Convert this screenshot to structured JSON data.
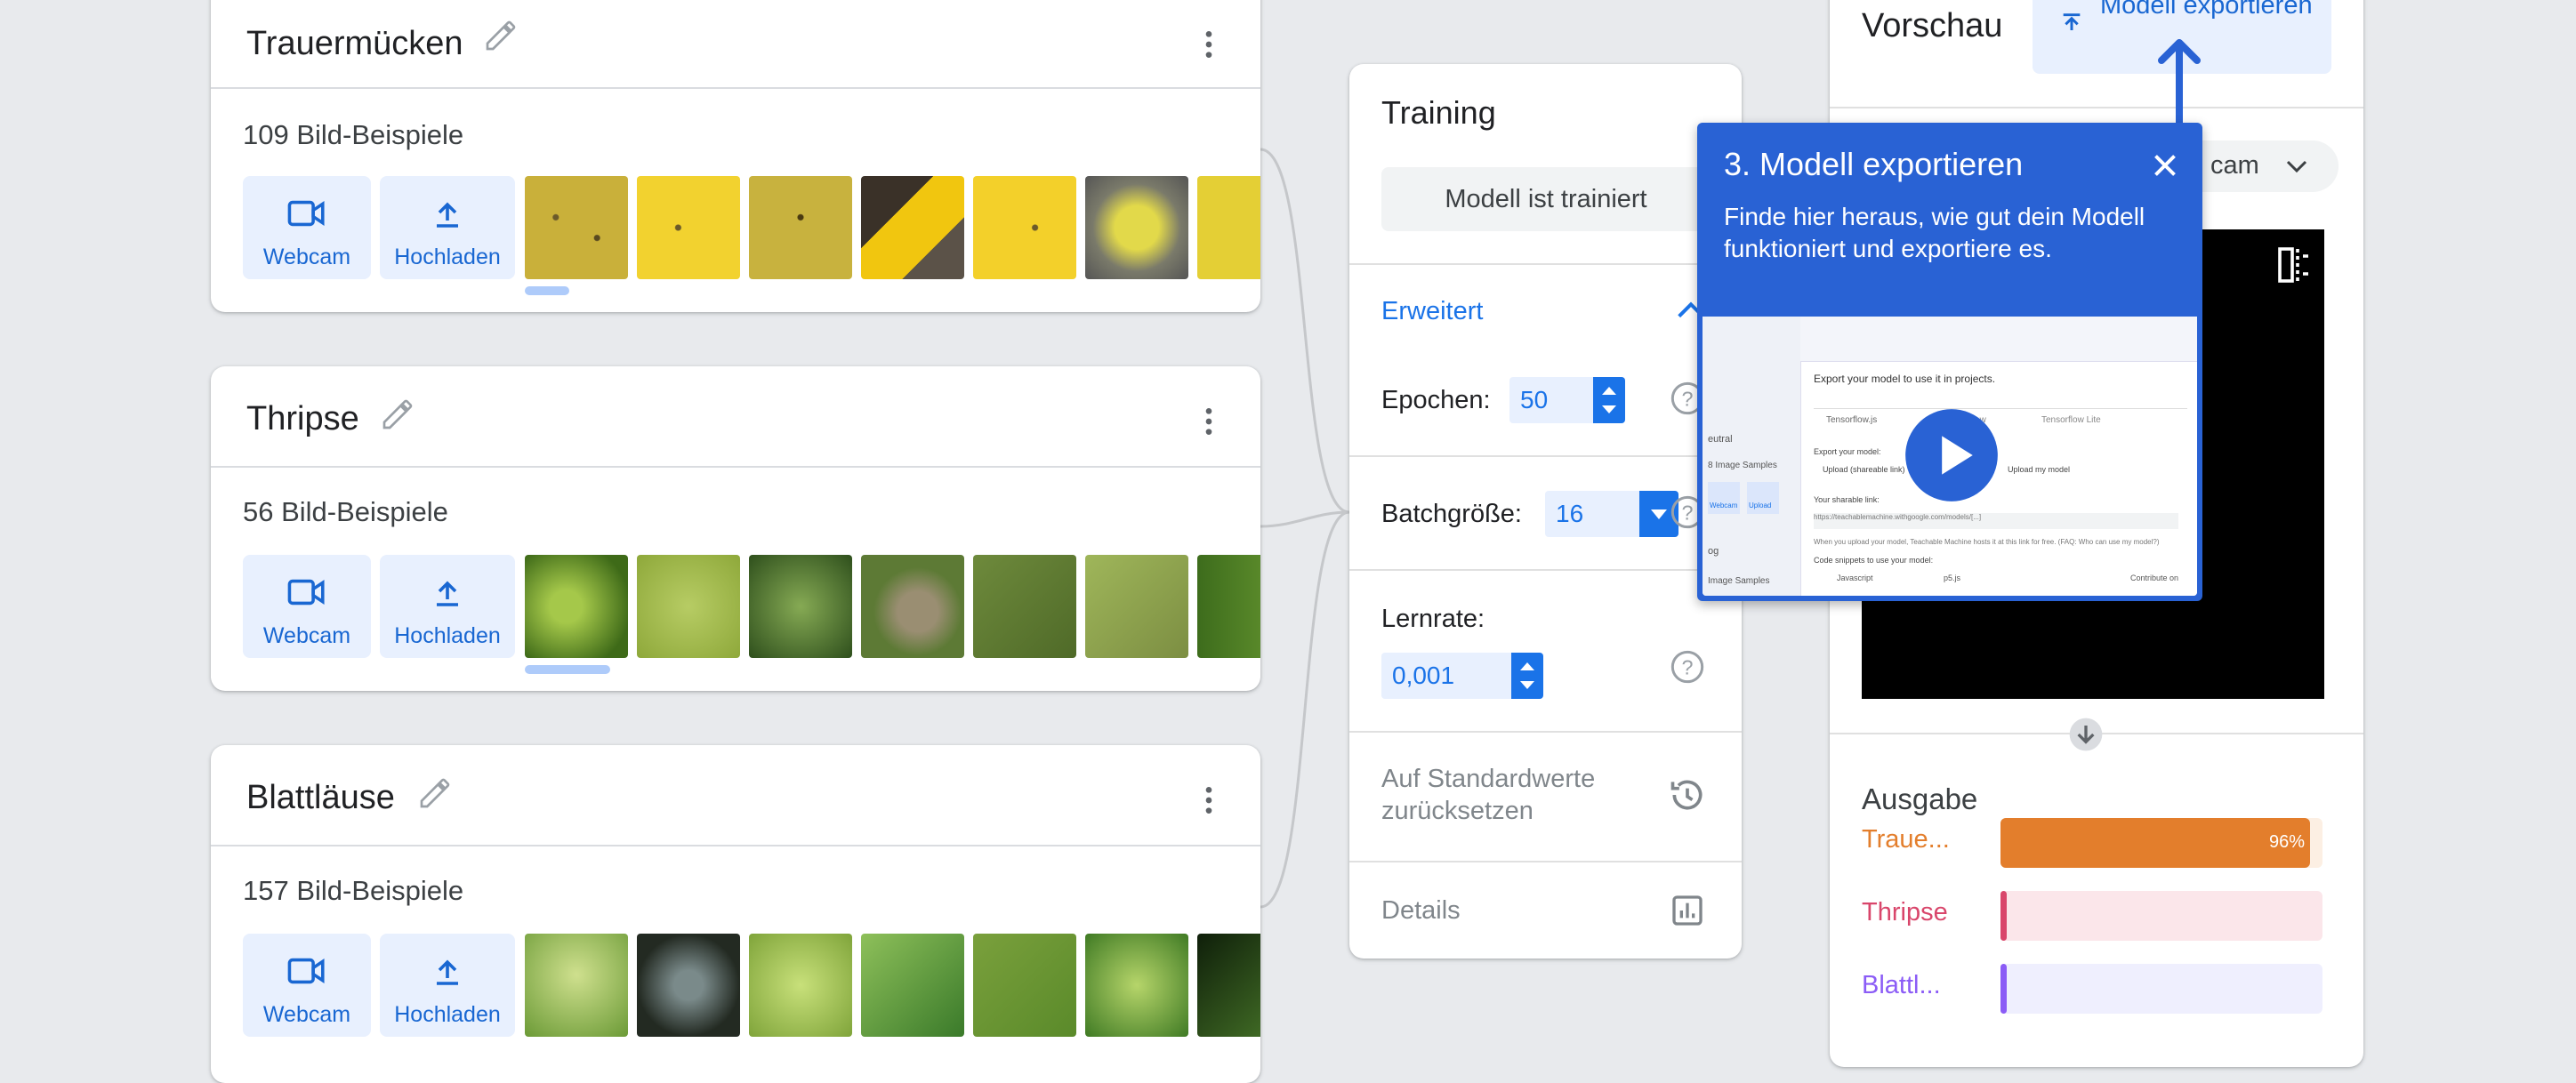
{
  "classes": [
    {
      "name": "Trauermücken",
      "count_label": "109 Bild-Beispiele"
    },
    {
      "name": "Thripse",
      "count_label": "56 Bild-Beispiele"
    },
    {
      "name": "Blattläuse",
      "count_label": "157 Bild-Beispiele"
    }
  ],
  "source_buttons": {
    "webcam": "Webcam",
    "upload": "Hochladen"
  },
  "training": {
    "title": "Training",
    "status_button": "Modell ist trainiert",
    "advanced_label": "Erweitert",
    "epochs_label": "Epochen:",
    "epochs_value": "50",
    "batch_label": "Batchgröße:",
    "batch_value": "16",
    "lr_label": "Lernrate:",
    "lr_value": "0,001",
    "reset_label": "Auf Standardwerte zurücksetzen",
    "details_label": "Details"
  },
  "preview": {
    "title": "Vorschau",
    "export_button": "Modell exportieren",
    "input_select": "cam",
    "output_title": "Ausgabe",
    "outputs": [
      {
        "label": "Traue...",
        "percent": 96,
        "percent_label": "96%",
        "color": "#e37e2c",
        "bg": "#fcefe3"
      },
      {
        "label": "Thripse",
        "percent": 2,
        "percent_label": "",
        "color": "#d9466b",
        "bg": "#fbe6ea"
      },
      {
        "label": "Blattl...",
        "percent": 1,
        "percent_label": "",
        "color": "#8b5cf6",
        "bg": "#efeffe"
      }
    ]
  },
  "tooltip": {
    "title": "3. Modell exportieren",
    "text": "Finde hier heraus, wie gut dein Modell funktioniert und exportiere es.",
    "video": {
      "heading": "Export your model to use it in projects.",
      "tabs": [
        "Tensorflow.js",
        "Tensorflow",
        "Tensorflow Lite"
      ],
      "export_label": "Export your model:",
      "opt1": "Upload (shareable link)",
      "opt2": "Upload my model",
      "link_label": "Your sharable link:",
      "link_value": "https://teachablemachine.withgoogle.com/models/[...]",
      "note": "When you upload your model, Teachable Machine hosts it at this link for free. (FAQ: Who can use my model?)",
      "snippets_label": "Code snippets to use your model:",
      "snippet_tabs": [
        "Javascript",
        "p5.js",
        "Contribute on"
      ],
      "side_items": [
        "eutral",
        "8 Image Samples",
        "Webcam",
        "Upload",
        "og",
        "Image Samples"
      ]
    }
  }
}
